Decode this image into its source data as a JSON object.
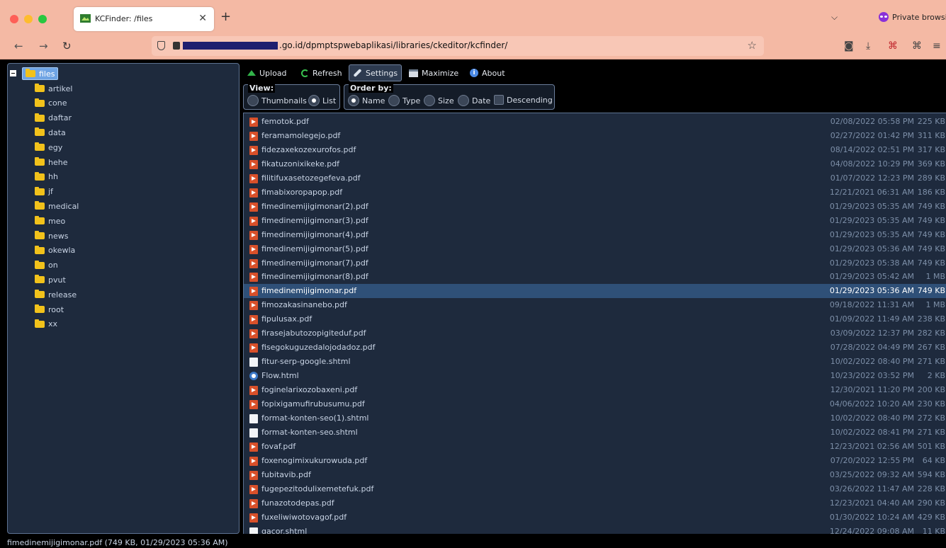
{
  "browser": {
    "tab_title": "KCFinder: /files",
    "tab_close": "✕",
    "new_tab": "+",
    "tab_overflow": "⌵",
    "private_label": "Private browsing",
    "url_visible": ".go.id/dpmptspwebaplikasi/libraries/ckeditor/kcfinder/",
    "nav": {
      "back": "←",
      "forward": "→",
      "reload": "↻"
    },
    "star": "☆",
    "tools": {
      "pocket": "◙",
      "download": "⤓",
      "extensions": "⌘",
      "menu": "≡"
    },
    "colors": {
      "chrome": "#f4b9a4",
      "urlbar": "#f8c7b6"
    }
  },
  "toolbar": {
    "upload": "Upload",
    "refresh": "Refresh",
    "settings": "Settings",
    "maximize": "Maximize",
    "about": "About"
  },
  "view": {
    "legend": "View:",
    "options": [
      "Thumbnails",
      "List"
    ],
    "selected": "List"
  },
  "order": {
    "legend": "Order by:",
    "options": [
      "Name",
      "Type",
      "Size",
      "Date"
    ],
    "selected": "Name",
    "descending_label": "Descending",
    "descending": false
  },
  "folders": {
    "root": "files",
    "children": [
      "artikel",
      "cone",
      "daftar",
      "data",
      "egy",
      "hehe",
      "hh",
      "jf",
      "medical",
      "meo",
      "news",
      "okewla",
      "on",
      "pvut",
      "release",
      "root",
      "xx"
    ]
  },
  "files": [
    {
      "name": "femotok.pdf",
      "type": "pdf",
      "date": "02/08/2022 05:58 PM",
      "size": "225 KB"
    },
    {
      "name": "feramamolegejo.pdf",
      "type": "pdf",
      "date": "02/27/2022 01:42 PM",
      "size": "311 KB"
    },
    {
      "name": "fidezaxekozexurofos.pdf",
      "type": "pdf",
      "date": "08/14/2022 02:51 PM",
      "size": "317 KB"
    },
    {
      "name": "fikatuzonixikeke.pdf",
      "type": "pdf",
      "date": "04/08/2022 10:29 PM",
      "size": "369 KB"
    },
    {
      "name": "filitifuxasetozegefeva.pdf",
      "type": "pdf",
      "date": "01/07/2022 12:23 PM",
      "size": "289 KB"
    },
    {
      "name": "fimabixoropapop.pdf",
      "type": "pdf",
      "date": "12/21/2021 06:31 AM",
      "size": "186 KB"
    },
    {
      "name": "fimedinemijigimonar(2).pdf",
      "type": "pdf",
      "date": "01/29/2023 05:35 AM",
      "size": "749 KB"
    },
    {
      "name": "fimedinemijigimonar(3).pdf",
      "type": "pdf",
      "date": "01/29/2023 05:35 AM",
      "size": "749 KB"
    },
    {
      "name": "fimedinemijigimonar(4).pdf",
      "type": "pdf",
      "date": "01/29/2023 05:35 AM",
      "size": "749 KB"
    },
    {
      "name": "fimedinemijigimonar(5).pdf",
      "type": "pdf",
      "date": "01/29/2023 05:36 AM",
      "size": "749 KB"
    },
    {
      "name": "fimedinemijigimonar(7).pdf",
      "type": "pdf",
      "date": "01/29/2023 05:38 AM",
      "size": "749 KB"
    },
    {
      "name": "fimedinemijigimonar(8).pdf",
      "type": "pdf",
      "date": "01/29/2023 05:42 AM",
      "size": "1 MB"
    },
    {
      "name": "fimedinemijigimonar.pdf",
      "type": "pdf",
      "date": "01/29/2023 05:36 AM",
      "size": "749 KB",
      "selected": true
    },
    {
      "name": "fimozakasinanebo.pdf",
      "type": "pdf",
      "date": "09/18/2022 11:31 AM",
      "size": "1 MB"
    },
    {
      "name": "fipulusax.pdf",
      "type": "pdf",
      "date": "01/09/2022 11:49 AM",
      "size": "238 KB"
    },
    {
      "name": "firasejabutozopigiteduf.pdf",
      "type": "pdf",
      "date": "03/09/2022 12:37 PM",
      "size": "282 KB"
    },
    {
      "name": "fisegokuguzedalojodadoz.pdf",
      "type": "pdf",
      "date": "07/28/2022 04:49 PM",
      "size": "267 KB"
    },
    {
      "name": "fitur-serp-google.shtml",
      "type": "page",
      "date": "10/02/2022 08:40 PM",
      "size": "271 KB"
    },
    {
      "name": "Flow.html",
      "type": "html",
      "date": "10/23/2022 03:52 PM",
      "size": "2 KB"
    },
    {
      "name": "foginelarixozobaxeni.pdf",
      "type": "pdf",
      "date": "12/30/2021 11:20 PM",
      "size": "200 KB"
    },
    {
      "name": "fopixigamufirubusumu.pdf",
      "type": "pdf",
      "date": "04/06/2022 10:20 AM",
      "size": "230 KB"
    },
    {
      "name": "format-konten-seo(1).shtml",
      "type": "page",
      "date": "10/02/2022 08:40 PM",
      "size": "272 KB"
    },
    {
      "name": "format-konten-seo.shtml",
      "type": "page",
      "date": "10/02/2022 08:41 PM",
      "size": "271 KB"
    },
    {
      "name": "fovaf.pdf",
      "type": "pdf",
      "date": "12/23/2021 02:56 AM",
      "size": "501 KB"
    },
    {
      "name": "foxenogimixukurowuda.pdf",
      "type": "pdf",
      "date": "07/20/2022 12:55 PM",
      "size": "64 KB"
    },
    {
      "name": "fubitavib.pdf",
      "type": "pdf",
      "date": "03/25/2022 09:32 AM",
      "size": "594 KB"
    },
    {
      "name": "fugepezitodulixemetefuk.pdf",
      "type": "pdf",
      "date": "03/26/2022 11:47 AM",
      "size": "228 KB"
    },
    {
      "name": "funazotodepas.pdf",
      "type": "pdf",
      "date": "12/23/2021 04:40 AM",
      "size": "290 KB"
    },
    {
      "name": "fuxeliwiwotovagof.pdf",
      "type": "pdf",
      "date": "01/30/2022 10:24 AM",
      "size": "429 KB"
    },
    {
      "name": "gacor.shtml",
      "type": "page",
      "date": "12/24/2022 09:08 AM",
      "size": "11 KB"
    }
  ],
  "status": "fimedinemijigimonar.pdf (749 KB, 01/29/2023 05:36 AM)"
}
